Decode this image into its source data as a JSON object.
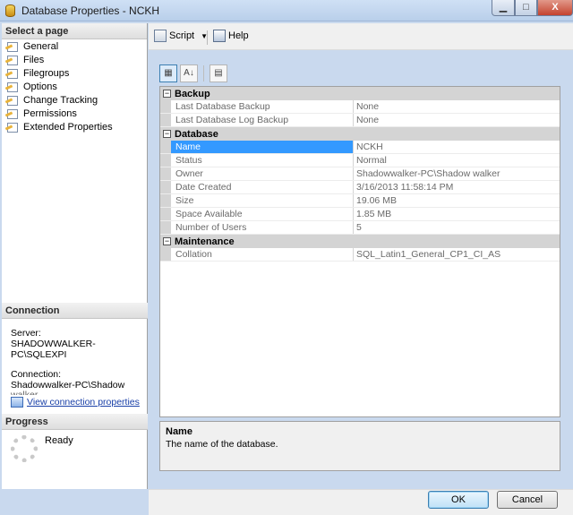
{
  "window": {
    "title": "Database Properties - NCKH",
    "min": "▁",
    "max": "□",
    "close": "X"
  },
  "select_page": {
    "heading": "Select a page",
    "items": [
      "General",
      "Files",
      "Filegroups",
      "Options",
      "Change Tracking",
      "Permissions",
      "Extended Properties"
    ]
  },
  "connection": {
    "heading": "Connection",
    "server_label": "Server:",
    "server_value": "SHADOWWALKER-PC\\SQLEXPI",
    "conn_label": "Connection:",
    "conn_value": "Shadowwalker-PC\\Shadow",
    "conn_value_cut": "walker",
    "link": "View connection properties"
  },
  "progress": {
    "heading": "Progress",
    "status": "Ready"
  },
  "toolbar": {
    "script": "Script",
    "help": "Help"
  },
  "grid_toolbar": {
    "categorized": "▦",
    "alpha": "A↓",
    "pages": "▤"
  },
  "grid": {
    "categories": [
      {
        "name": "Backup",
        "toggle": "−",
        "rows": [
          {
            "name": "Last Database Backup",
            "value": "None"
          },
          {
            "name": "Last Database Log Backup",
            "value": "None"
          }
        ]
      },
      {
        "name": "Database",
        "toggle": "−",
        "rows": [
          {
            "name": "Name",
            "value": "NCKH"
          },
          {
            "name": "Status",
            "value": "Normal"
          },
          {
            "name": "Owner",
            "value": "Shadowwalker-PC\\Shadow walker"
          },
          {
            "name": "Date Created",
            "value": "3/16/2013 11:58:14 PM"
          },
          {
            "name": "Size",
            "value": "19.06 MB"
          },
          {
            "name": "Space Available",
            "value": "1.85 MB"
          },
          {
            "name": "Number of Users",
            "value": "5"
          }
        ]
      },
      {
        "name": "Maintenance",
        "toggle": "−",
        "rows": [
          {
            "name": "Collation",
            "value": "SQL_Latin1_General_CP1_CI_AS"
          }
        ]
      }
    ]
  },
  "description": {
    "title": "Name",
    "text": "The name of the database."
  },
  "buttons": {
    "ok": "OK",
    "cancel": "Cancel"
  }
}
